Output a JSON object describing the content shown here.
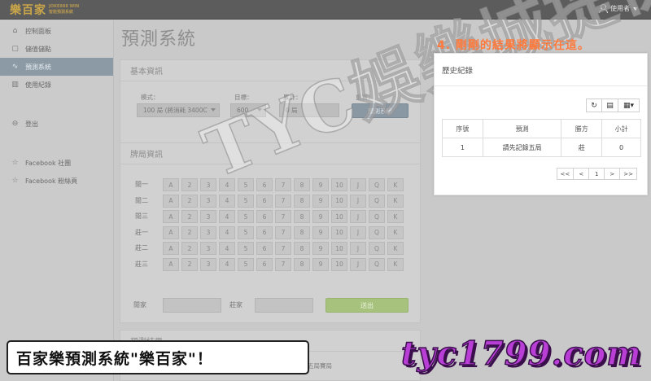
{
  "brand": {
    "name": "樂百家",
    "sub_line1": "JOKE888 WIN",
    "sub_line2": "智能預測系統"
  },
  "user_menu": {
    "label": "使用者"
  },
  "sidebar": {
    "items": [
      {
        "label": "控制面板",
        "icon": "dashboard-icon"
      },
      {
        "label": "儲值儲點",
        "icon": "wallet-icon"
      },
      {
        "label": "預測系統",
        "icon": "chart-icon",
        "active": true
      },
      {
        "label": "使用紀錄",
        "icon": "record-icon"
      }
    ],
    "logout": {
      "label": "登出",
      "icon": "logout-icon"
    },
    "links": [
      {
        "label": "Facebook 社團",
        "icon": "star-icon"
      },
      {
        "label": "Facebook 粉絲頁",
        "icon": "star-icon"
      }
    ]
  },
  "page": {
    "title": "預測系統"
  },
  "basic": {
    "title": "基本資訊",
    "mode_label": "模式：",
    "mode_value": "100 局 (將消耗 3400C",
    "target_label": "目標：",
    "target_value": "600",
    "total_label": "累計：",
    "total_value": "0 局",
    "reset_label": "重置：",
    "reset_button": "預測系統"
  },
  "cards": {
    "title": "牌局資訊",
    "row_labels": [
      "閒一",
      "閒二",
      "閒三",
      "莊一",
      "莊二",
      "莊三"
    ],
    "values": [
      "A",
      "2",
      "3",
      "4",
      "5",
      "6",
      "7",
      "8",
      "9",
      "10",
      "J",
      "Q",
      "K"
    ],
    "result_label_left": "閒家",
    "result_label_right": "莊家",
    "submit_button": "送出"
  },
  "prediction": {
    "title": "預測結果",
    "placeholder": "請先記錄五局賽局"
  },
  "history": {
    "title": "歷史紀錄",
    "toolbar": [
      "refresh-icon",
      "columns-icon",
      "grid-icon"
    ],
    "columns": [
      "序號",
      "預測",
      "勝方",
      "小計"
    ],
    "rows": [
      {
        "no": "1",
        "prediction": "請先記錄五局",
        "winner": "莊",
        "subtotal": "0"
      }
    ],
    "pagination": [
      "<<",
      "<",
      "1",
      ">",
      ">>"
    ]
  },
  "annotation": "4. 剛剛的結果將顯示在這。",
  "watermark": "TYC娛樂城提供",
  "caption": "百家樂預測系統\"樂百家\"！",
  "site": "tyc1799.com"
}
